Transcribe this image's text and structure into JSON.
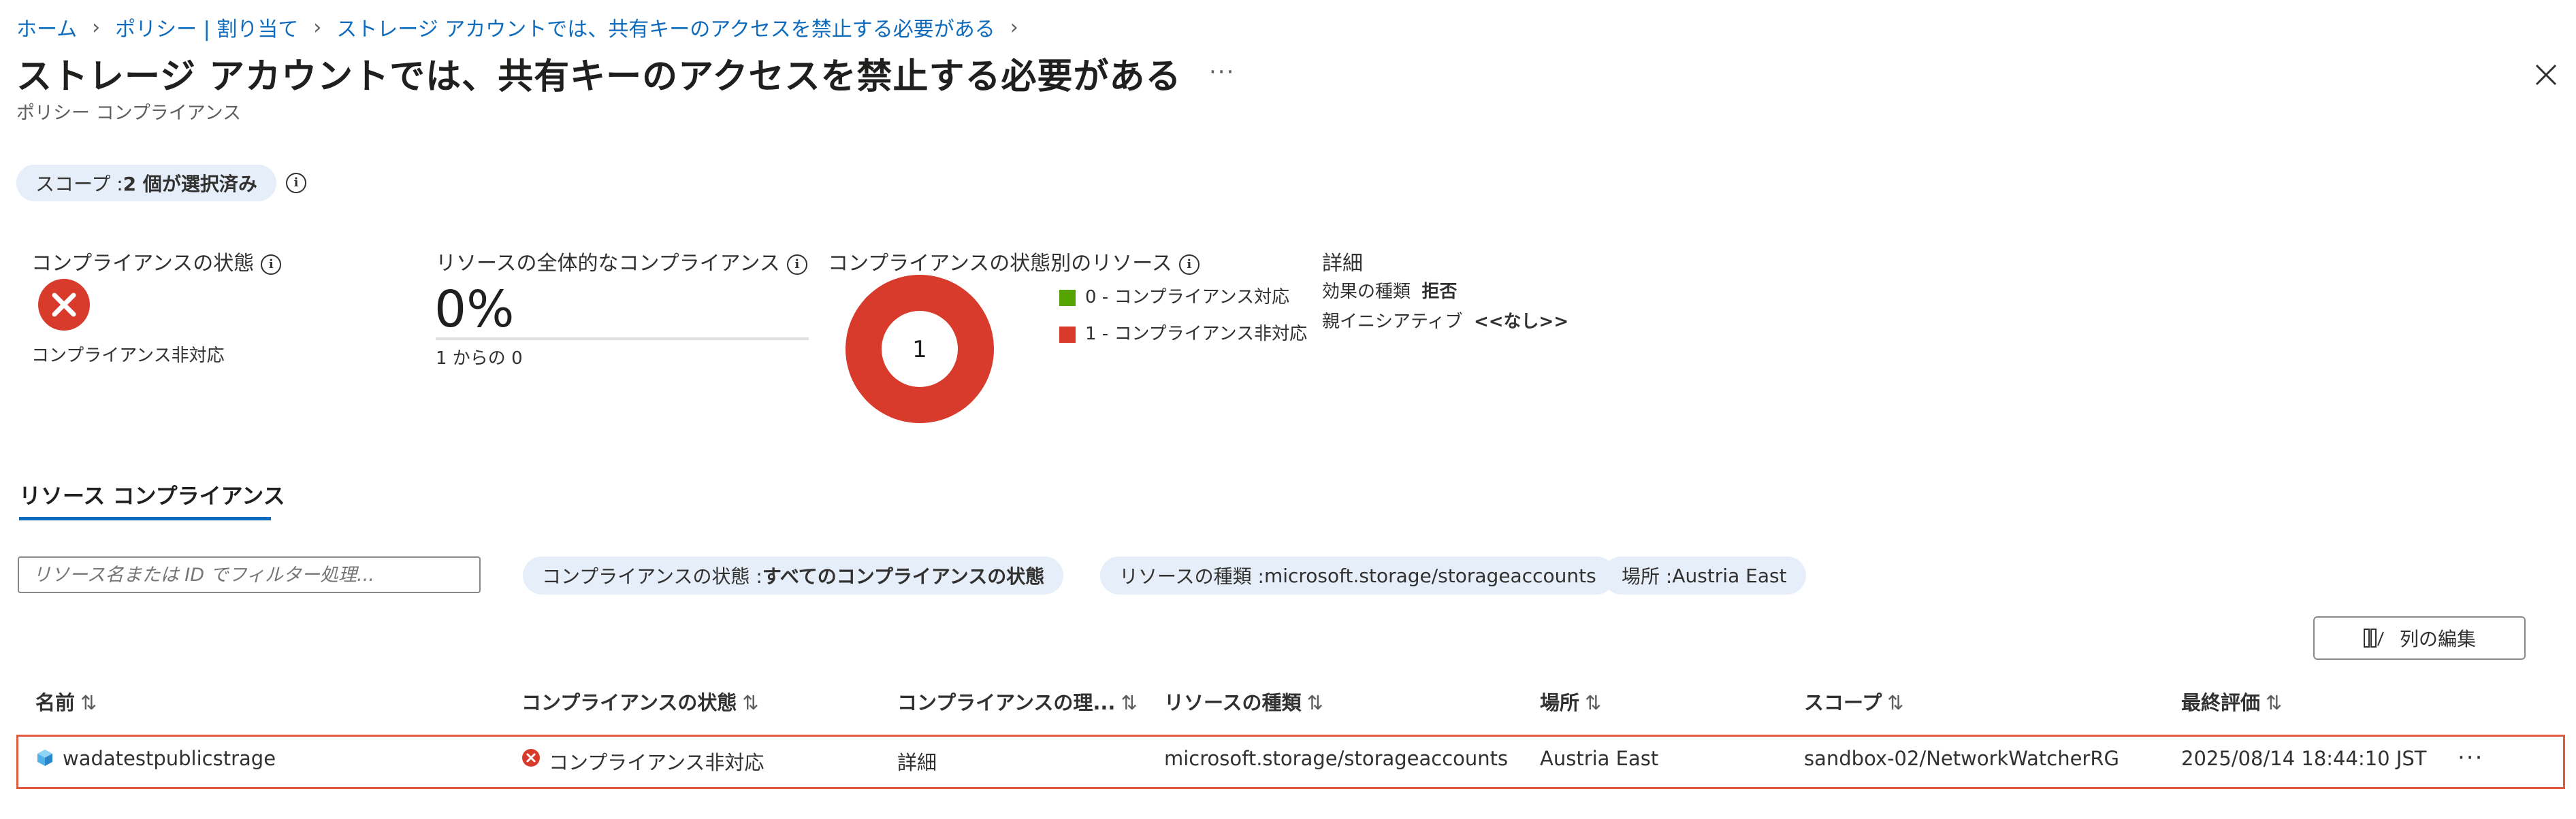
{
  "breadcrumb": {
    "home": "ホーム",
    "policy": "ポリシー | 割り当て",
    "current": "ストレージ アカウントでは、共有キーのアクセスを禁止する必要がある"
  },
  "header": {
    "title": "ストレージ アカウントでは、共有キーのアクセスを禁止する必要がある",
    "subtitle": "ポリシー コンプライアンス",
    "more": "···"
  },
  "scope": {
    "label": "スコープ : ",
    "value": "2 個が選択済み"
  },
  "summary": {
    "compliance_state": {
      "label": "コンプライアンスの状態",
      "value": "コンプライアンス非対応"
    },
    "overall": {
      "label": "リソースの全体的なコンプライアンス",
      "percent": "0%",
      "sub": "1 からの 0"
    },
    "by_state": {
      "label": "コンプライアンスの状態別のリソース",
      "center": "1",
      "legend": [
        {
          "text": "0 - コンプライアンス対応",
          "color": "#57a300"
        },
        {
          "text": "1 - コンプライアンス非対応",
          "color": "#d83b2b"
        }
      ]
    },
    "details": {
      "label": "詳細",
      "effect_label": "効果の種類",
      "effect_value": "拒否",
      "parent_label": "親イニシアティブ",
      "parent_value": "<<なし>>"
    }
  },
  "tab": {
    "label": "リソース コンプライアンス"
  },
  "filters": {
    "search_placeholder": "リソース名または ID でフィルター処理...",
    "state": {
      "label": "コンプライアンスの状態 : ",
      "value": "すべてのコンプライアンスの状態"
    },
    "type": {
      "label": "リソースの種類 : ",
      "value": "microsoft.storage/storageaccounts"
    },
    "location": {
      "label": "場所 : ",
      "value": "Austria East"
    }
  },
  "toolbar": {
    "edit_columns": "列の編集"
  },
  "table": {
    "headers": [
      "名前",
      "コンプライアンスの状態",
      "コンプライアンスの理...",
      "リソースの種類",
      "場所",
      "スコープ",
      "最終評価"
    ],
    "rows": [
      {
        "name": "wadatestpublicstrage",
        "state": "コンプライアンス非対応",
        "reason": "詳細",
        "type": "microsoft.storage/storageaccounts",
        "location": "Austria East",
        "scope": "sandbox-02/NetworkWatcherRG",
        "last_eval": "2025/08/14 18:44:10 JST",
        "more": "···"
      }
    ]
  },
  "colors": {
    "accent": "#0f6cbd",
    "error": "#d83b2b",
    "success": "#57a300"
  }
}
